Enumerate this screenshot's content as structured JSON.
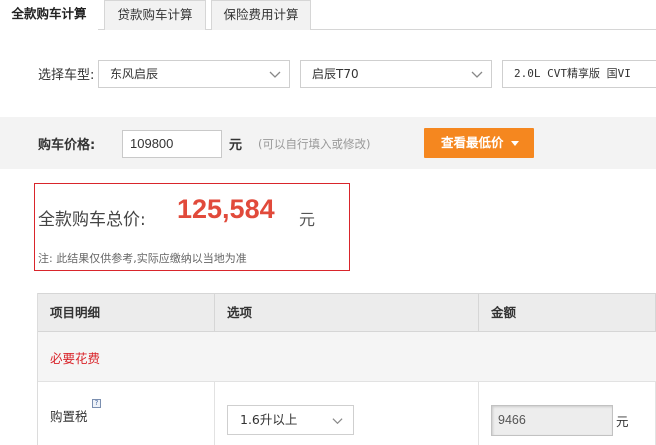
{
  "tabs": [
    {
      "label": "全款购车计算",
      "active": true
    },
    {
      "label": "贷款购车计算",
      "active": false
    },
    {
      "label": "保险费用计算",
      "active": false
    }
  ],
  "car_select": {
    "label": "选择车型:",
    "brand": "东风启辰",
    "series": "启辰T70",
    "model": "2.0L CVT精享版 国VI"
  },
  "price": {
    "label": "购车价格:",
    "value": "109800",
    "unit": "元",
    "hint": "(可以自行填入或修改)",
    "button_label": "查看最低价"
  },
  "total": {
    "label": "全款购车总价:",
    "value": "125,584",
    "unit": "元",
    "note": "注: 此结果仅供参考,实际应缴纳以当地为准"
  },
  "table": {
    "headers": [
      "项目明细",
      "选项",
      "金额"
    ],
    "group_label": "必要花费",
    "row": {
      "name": "购置税",
      "help_icon_text": "?",
      "option": "1.6升以上",
      "amount": "9466",
      "unit": "元"
    }
  },
  "colors": {
    "accent_orange": "#f5871f",
    "total_red": "#e14a3b",
    "border_red": "#d9252b"
  }
}
